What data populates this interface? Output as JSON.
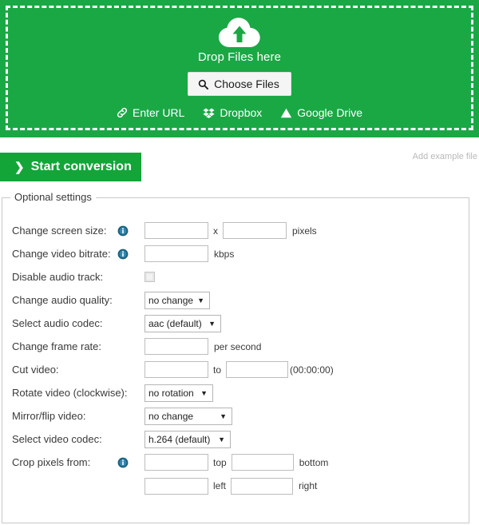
{
  "upload": {
    "cloud_icon": "cloud-upload-icon",
    "drop_text": "Drop Files here",
    "choose_files_label": "Choose Files",
    "choose_files_icon": "search-icon",
    "links": [
      {
        "label": "Enter URL",
        "icon": "link-icon"
      },
      {
        "label": "Dropbox",
        "icon": "dropbox-icon"
      },
      {
        "label": "Google Drive",
        "icon": "google-drive-icon"
      }
    ],
    "background_color": "#1aa845"
  },
  "actions": {
    "start_label": "Start conversion",
    "start_chevron": "chevron-right-icon",
    "start_color": "#13a538",
    "example_label": "Add example file"
  },
  "settings": {
    "legend": "Optional settings",
    "rows": {
      "screen_size": {
        "label": "Change screen size:",
        "info_icon": "info-icon",
        "width_value": "",
        "separator": "x",
        "height_value": "",
        "unit": "pixels"
      },
      "video_bitrate": {
        "label": "Change video bitrate:",
        "info_icon": "info-icon",
        "value": "",
        "unit": "kbps"
      },
      "disable_audio": {
        "label": "Disable audio track:",
        "checked": false
      },
      "audio_quality": {
        "label": "Change audio quality:",
        "value": "no change",
        "options": [
          "no change"
        ]
      },
      "audio_codec": {
        "label": "Select audio codec:",
        "value": "aac (default)",
        "options": [
          "aac (default)"
        ]
      },
      "frame_rate": {
        "label": "Change frame rate:",
        "value": "",
        "unit": "per second"
      },
      "cut_video": {
        "label": "Cut video:",
        "from_value": "",
        "separator": "to",
        "to_value": "",
        "hint": "(00:00:00)"
      },
      "rotate_video": {
        "label": "Rotate video (clockwise):",
        "value": "no rotation",
        "options": [
          "no rotation"
        ]
      },
      "mirror_flip": {
        "label": "Mirror/flip video:",
        "value": "no change",
        "options": [
          "no change"
        ]
      },
      "video_codec": {
        "label": "Select video codec:",
        "value": "h.264 (default)",
        "options": [
          "h.264 (default)"
        ]
      },
      "crop": {
        "label": "Crop pixels from:",
        "info_icon": "info-icon",
        "top_value": "",
        "top_unit": "top",
        "bottom_value": "",
        "bottom_unit": "bottom",
        "left_value": "",
        "left_unit": "left",
        "right_value": "",
        "right_unit": "right"
      }
    }
  }
}
